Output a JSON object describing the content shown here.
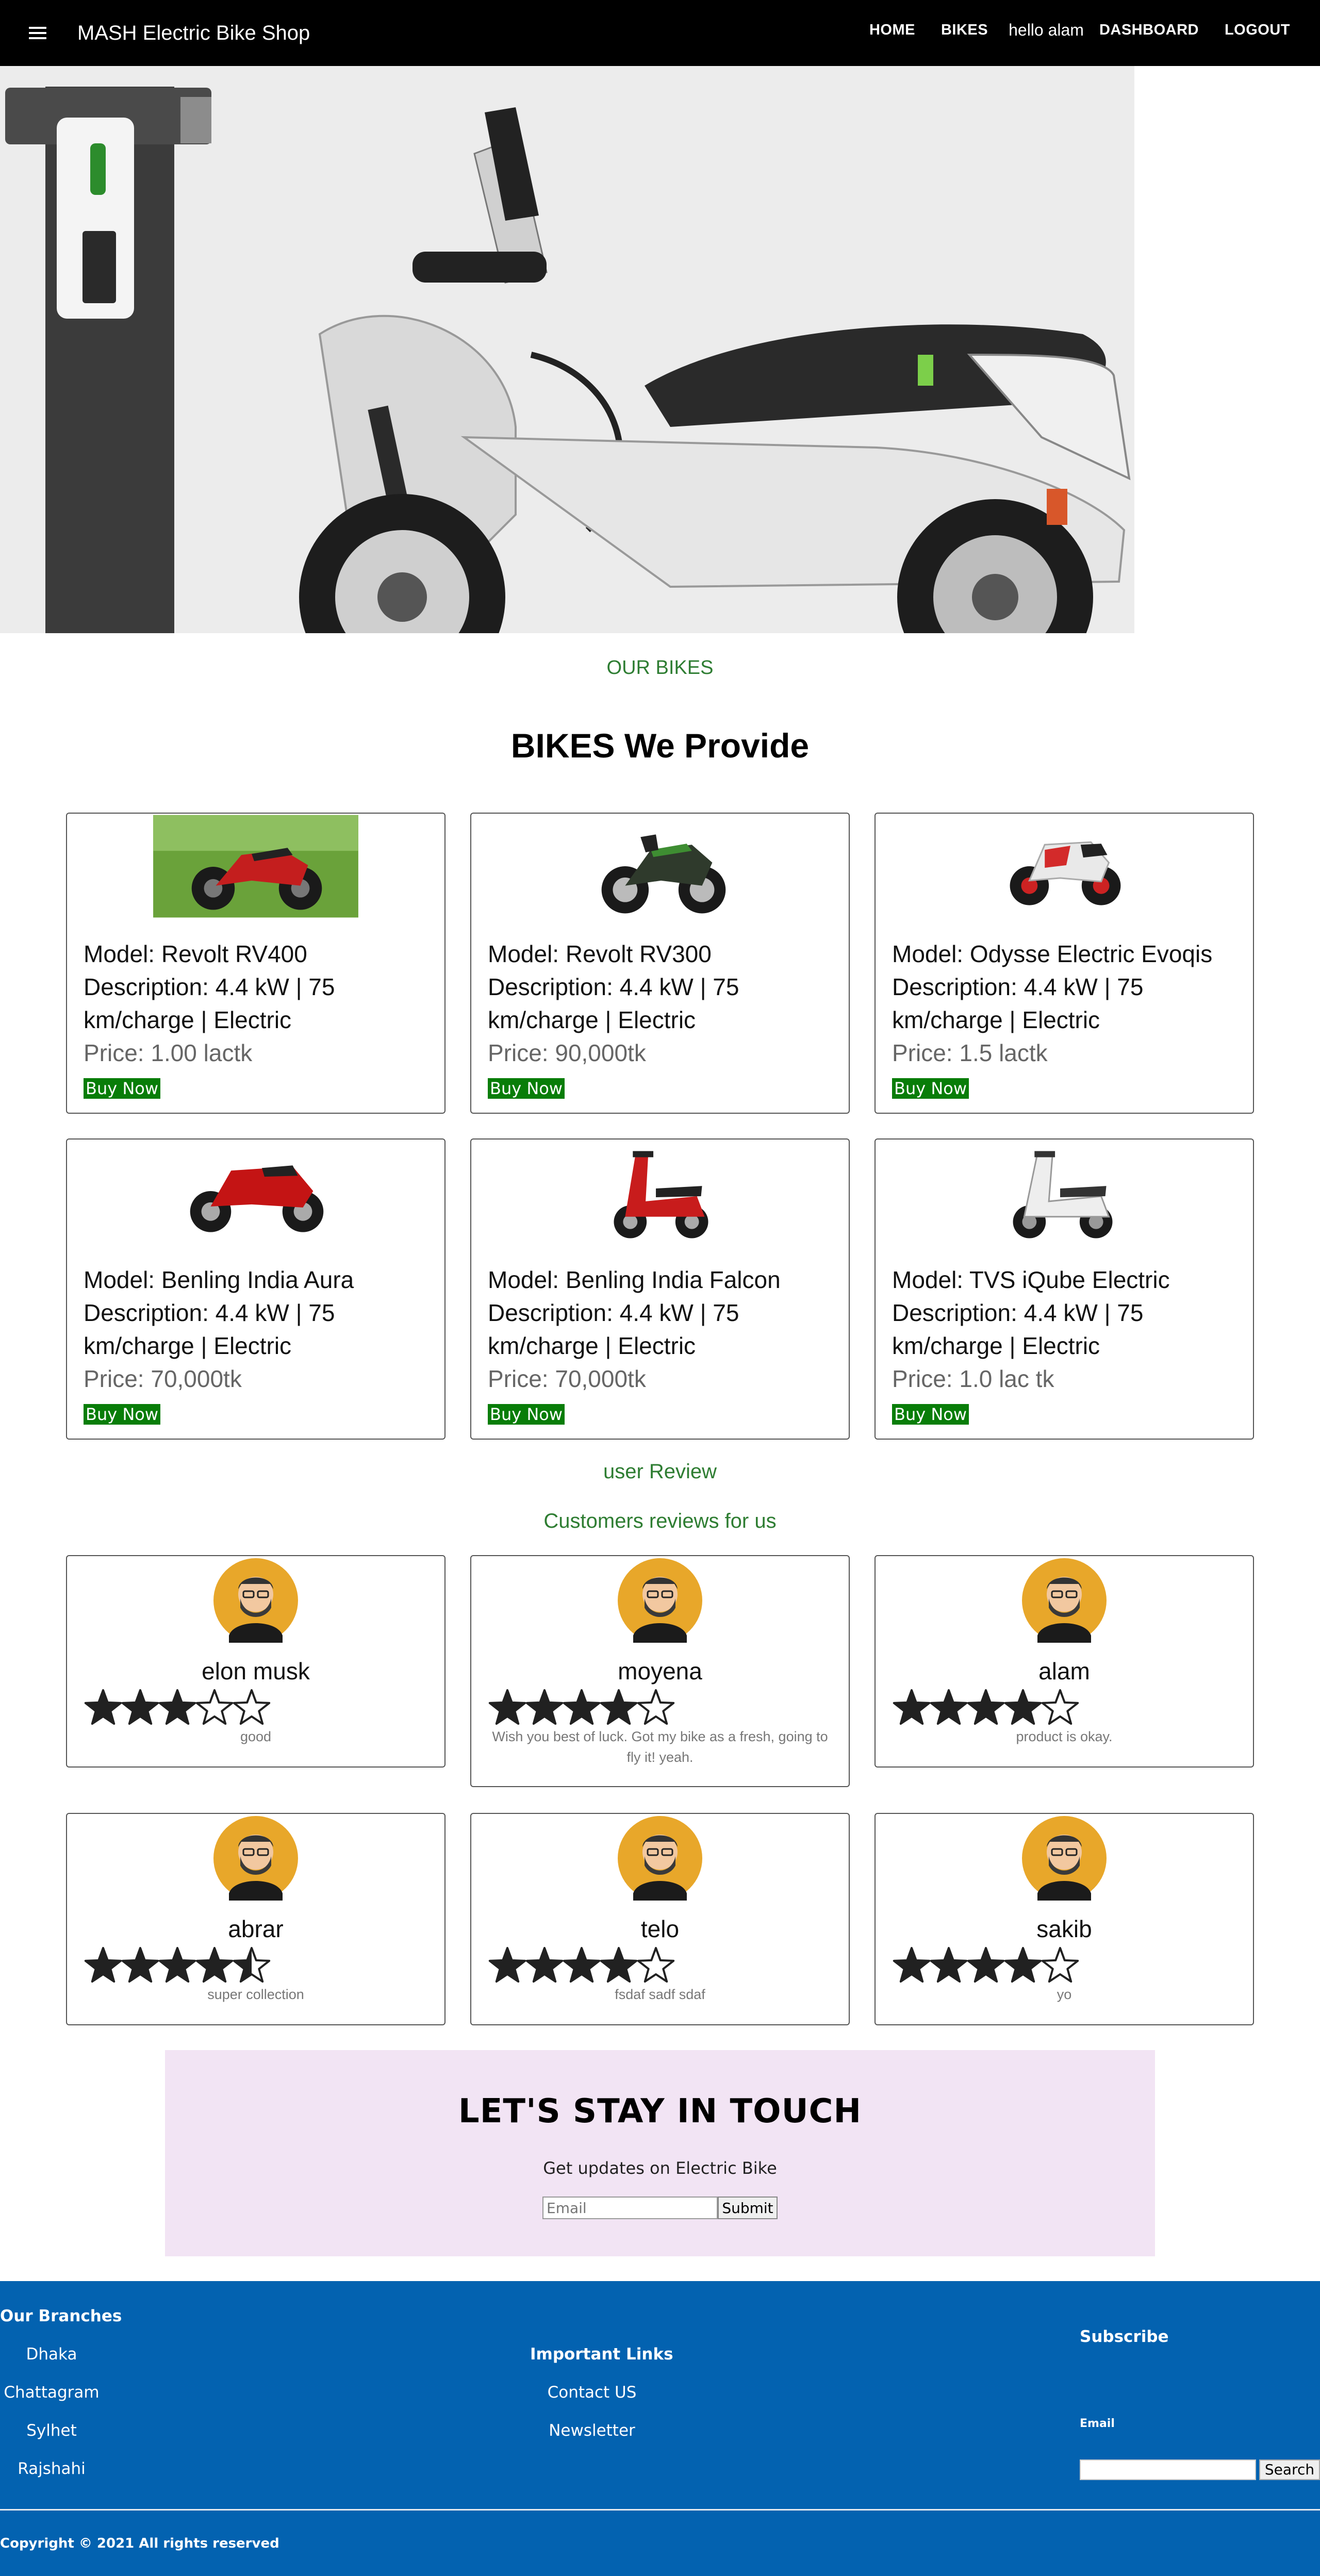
{
  "navbar": {
    "brand": "MASH Electric Bike Shop",
    "links": {
      "home": "HOME",
      "bikes": "BIKES",
      "hello": "hello alam",
      "dashboard": "DASHBOARD",
      "logout": "LOGOUT"
    }
  },
  "bikes_section": {
    "tag": "OUR BIKES",
    "title": "BIKES We Provide",
    "buy_label": "Buy Now",
    "items": [
      {
        "model": "Model: Revolt RV400",
        "description": "Description: 4.4 kW | 75 km/charge | Electric",
        "price": "Price: 1.00 lactk"
      },
      {
        "model": "Model: Revolt RV300",
        "description": "Description: 4.4 kW | 75 km/charge | Electric",
        "price": "Price: 90,000tk"
      },
      {
        "model": "Model: Odysse Electric Evoqis",
        "description": "Description: 4.4 kW | 75 km/charge | Electric",
        "price": "Price: 1.5 lactk"
      },
      {
        "model": "Model: Benling India Aura",
        "description": "Description: 4.4 kW | 75 km/charge | Electric",
        "price": "Price: 70,000tk"
      },
      {
        "model": "Model: Benling India Falcon",
        "description": "Description: 4.4 kW | 75 km/charge | Electric",
        "price": "Price: 70,000tk"
      },
      {
        "model": "Model: TVS iQube Electric",
        "description": "Description: 4.4 kW | 75 km/charge | Electric",
        "price": "Price: 1.0 lac tk"
      }
    ]
  },
  "reviews_section": {
    "tag": "user Review",
    "subtitle": "Customers reviews for us",
    "items": [
      {
        "name": "elon musk",
        "rating": 3,
        "text": "good"
      },
      {
        "name": "moyena",
        "rating": 4,
        "text": "Wish you best of luck. Got my bike as a fresh, going to fly it! yeah."
      },
      {
        "name": "alam",
        "rating": 4,
        "text": "product is okay."
      },
      {
        "name": "abrar",
        "rating": 4.5,
        "text": "super collection"
      },
      {
        "name": "telo",
        "rating": 4,
        "text": "fsdaf sadf sdaf"
      },
      {
        "name": "sakib",
        "rating": 4,
        "text": "yo"
      }
    ]
  },
  "newsletter": {
    "title": "LET'S STAY IN TOUCH",
    "subtitle": "Get updates on Electric Bike",
    "email_placeholder": "Email",
    "submit_label": "Submit"
  },
  "footer": {
    "branches_heading": "Our Branches",
    "branches": [
      "Dhaka",
      "Chattagram",
      "Sylhet",
      "Rajshahi"
    ],
    "links_heading": "Important Links",
    "links": [
      "Contact US",
      "Newsletter"
    ],
    "subscribe_heading": "Subscribe",
    "email_label": "Email",
    "search_label": "Search",
    "copyright": "Copyright © 2021 All rights reserved"
  },
  "colors": {
    "nav": "#000000",
    "accent_green": "#2e7d32",
    "buy_button": "#087d08",
    "footer": "#0362b0",
    "newsletter_bg": "#f2e4f4"
  }
}
